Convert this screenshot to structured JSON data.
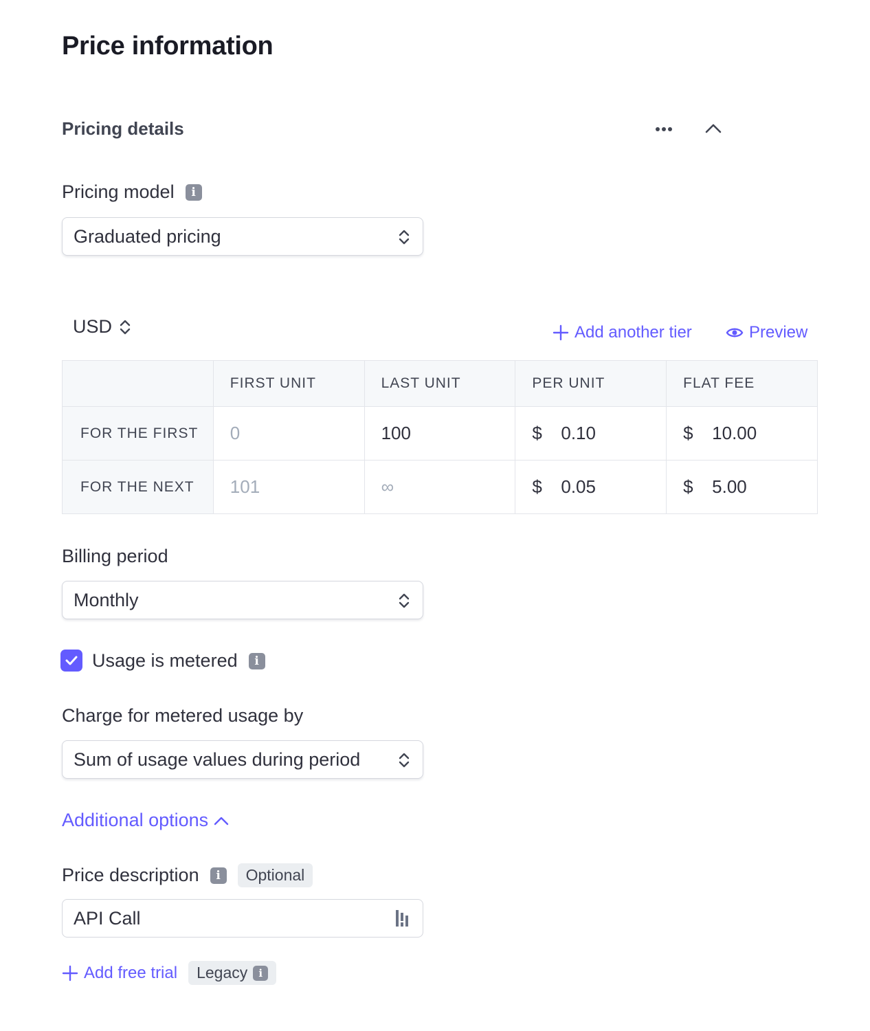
{
  "page": {
    "title": "Price information"
  },
  "section": {
    "title": "Pricing details"
  },
  "pricing_model": {
    "label": "Pricing model",
    "value": "Graduated pricing"
  },
  "currency": {
    "value": "USD"
  },
  "actions": {
    "add_tier": "Add another tier",
    "preview": "Preview"
  },
  "tiers": {
    "headers": [
      "",
      "FIRST UNIT",
      "LAST UNIT",
      "PER UNIT",
      "FLAT FEE"
    ],
    "rows": [
      {
        "label": "FOR THE FIRST",
        "first_unit": "0",
        "last_unit": "100",
        "per_unit": "0.10",
        "flat_fee": "10.00"
      },
      {
        "label": "FOR THE NEXT",
        "first_unit": "101",
        "last_unit": "∞",
        "per_unit": "0.05",
        "flat_fee": "5.00"
      }
    ],
    "currency_symbol": "$"
  },
  "billing_period": {
    "label": "Billing period",
    "value": "Monthly"
  },
  "metered": {
    "label": "Usage is metered",
    "checked": true
  },
  "charge_by": {
    "label": "Charge for metered usage by",
    "value": "Sum of usage values during period"
  },
  "additional_options": {
    "label": "Additional options"
  },
  "price_description": {
    "label": "Price description",
    "badge": "Optional",
    "value": "API Call"
  },
  "free_trial": {
    "label": "Add free trial",
    "badge": "Legacy"
  },
  "colors": {
    "accent": "#635bff",
    "text": "#30313d",
    "muted": "#a3acb9",
    "header_bg": "#f6f8fa"
  }
}
